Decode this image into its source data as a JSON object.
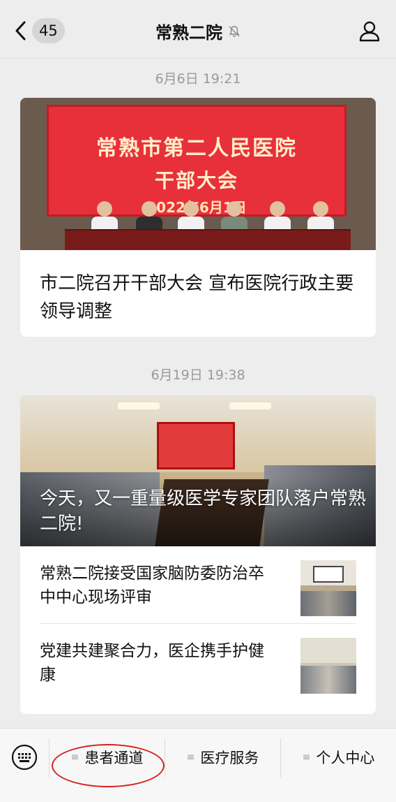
{
  "header": {
    "unread_count": "45",
    "title": "常熟二院"
  },
  "feed": [
    {
      "timestamp": "6月6日 19:21",
      "hero_image": {
        "banner_line1": "常熟市第二人民医院",
        "banner_line2": "干部大会",
        "banner_line3": "2022年6月1日"
      },
      "title": "市二院召开干部大会 宣布医院行政主要领导调整"
    },
    {
      "timestamp": "6月19日 19:38",
      "hero_title": "今天，又一重量级医学专家团队落户常熟二院!",
      "sub_items": [
        {
          "title": "常熟二院接受国家脑防委防治卒中中心现场评审"
        },
        {
          "title": "党建共建聚合力，医企携手护健康"
        }
      ]
    }
  ],
  "menu": {
    "items": [
      {
        "label": "患者通道"
      },
      {
        "label": "医疗服务"
      },
      {
        "label": "个人中心"
      }
    ],
    "highlight_color": "#d62020"
  },
  "icons": {
    "back": "chevron-left-icon",
    "mute": "bell-muted-icon",
    "profile": "person-icon",
    "keyboard": "keyboard-icon",
    "menu_lines": "menu-lines-icon"
  }
}
